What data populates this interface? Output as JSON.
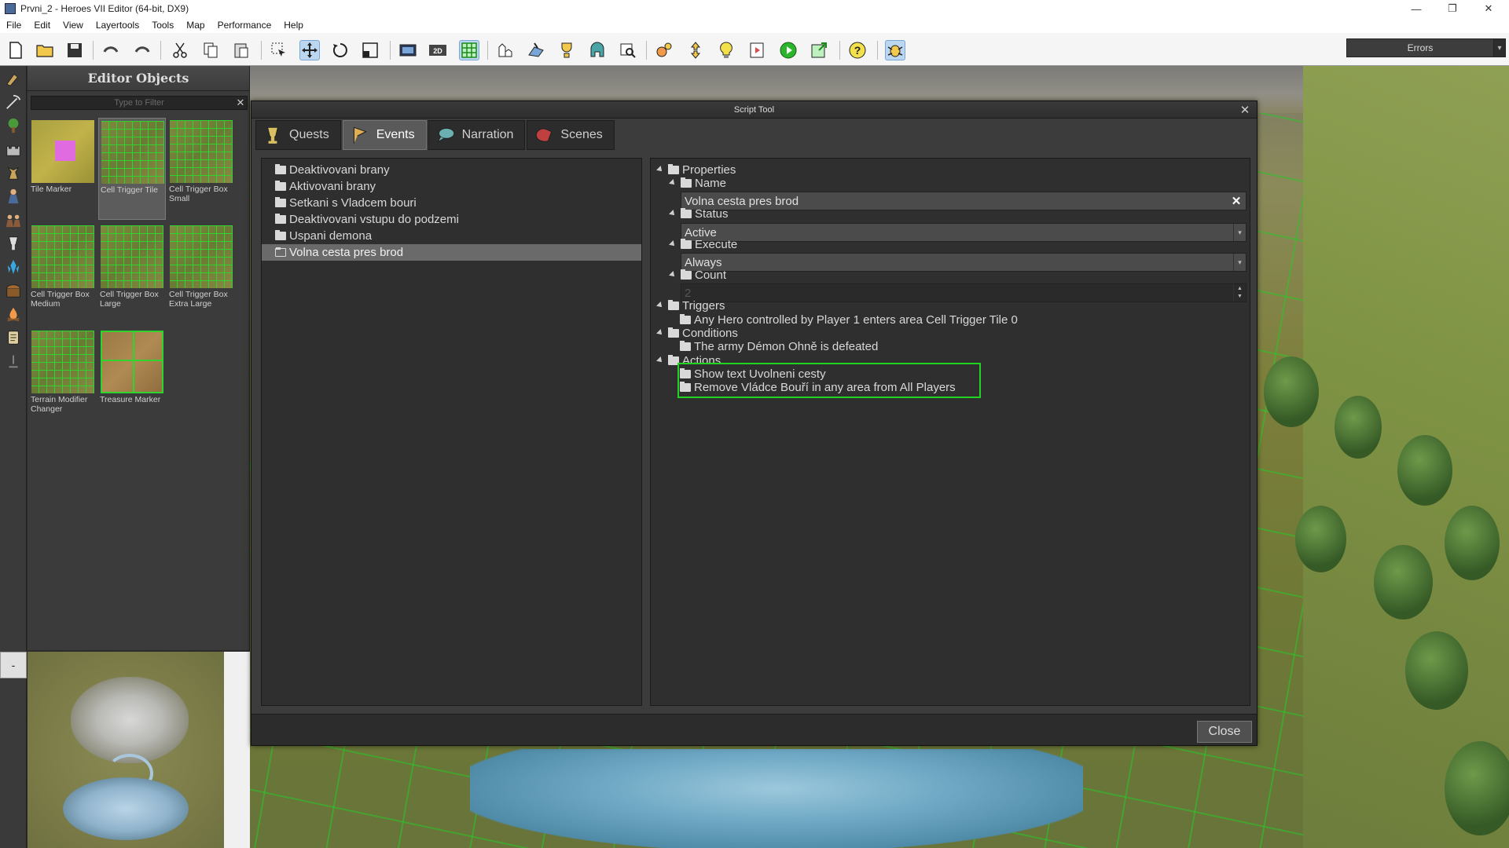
{
  "window": {
    "title": "Prvni_2 - Heroes VII Editor (64-bit, DX9)",
    "minimize": "—",
    "restore": "❐",
    "close": "✕"
  },
  "menu": [
    "File",
    "Edit",
    "View",
    "Layertools",
    "Tools",
    "Map",
    "Performance",
    "Help"
  ],
  "toolbar": {
    "errors_label": "Errors",
    "errors_dropdown": "▾"
  },
  "editor_objects": {
    "title": "Editor Objects",
    "filter_placeholder": "Type to Filter",
    "filter_clear": "✕",
    "items": [
      {
        "label": "Tile Marker"
      },
      {
        "label": "Cell Trigger Tile",
        "selected": true
      },
      {
        "label": "Cell Trigger Box Small"
      },
      {
        "label": "Cell Trigger Box Medium"
      },
      {
        "label": "Cell Trigger Box Large"
      },
      {
        "label": "Cell Trigger Box Extra Large"
      },
      {
        "label": "Terrain Modifier Changer"
      },
      {
        "label": "Treasure Marker"
      }
    ]
  },
  "minimap": {
    "collapse_label": "-"
  },
  "script_tool": {
    "title": "Script Tool",
    "close_x": "✕",
    "tabs": [
      {
        "label": "Quests",
        "icon": "chalice-icon"
      },
      {
        "label": "Events",
        "icon": "flag-icon",
        "active": true
      },
      {
        "label": "Narration",
        "icon": "speech-icon"
      },
      {
        "label": "Scenes",
        "icon": "film-icon"
      }
    ],
    "events": [
      {
        "label": "Deaktivovani brany"
      },
      {
        "label": "Aktivovani brany"
      },
      {
        "label": "Setkani s Vladcem bouri"
      },
      {
        "label": "Deaktivovani vstupu do podzemi"
      },
      {
        "label": "Uspani demona"
      },
      {
        "label": "Volna cesta pres brod",
        "selected": true
      }
    ],
    "properties": {
      "root_label": "Properties",
      "name_label": "Name",
      "name_value": "Volna cesta pres brod",
      "name_clear": "✕",
      "status_label": "Status",
      "status_value": "Active",
      "execute_label": "Execute",
      "execute_value": "Always",
      "count_label": "Count",
      "count_value": "2",
      "dropdown_arrow": "▾",
      "spin_up": "▲",
      "spin_down": "▼"
    },
    "triggers": {
      "label": "Triggers",
      "items": [
        "Any Hero controlled by Player 1 enters area Cell Trigger Tile 0"
      ]
    },
    "conditions": {
      "label": "Conditions",
      "items": [
        "The army Démon Ohně is defeated"
      ]
    },
    "actions": {
      "label": "Actions",
      "items": [
        "Show text Uvolneni cesty",
        "Remove Vládce Bouří in any area from All Players"
      ]
    },
    "close_button": "Close"
  },
  "colors": {
    "highlight": "#22d422",
    "dialog_bg": "#3c3c3c",
    "selected_row": "#6a6a6a"
  }
}
